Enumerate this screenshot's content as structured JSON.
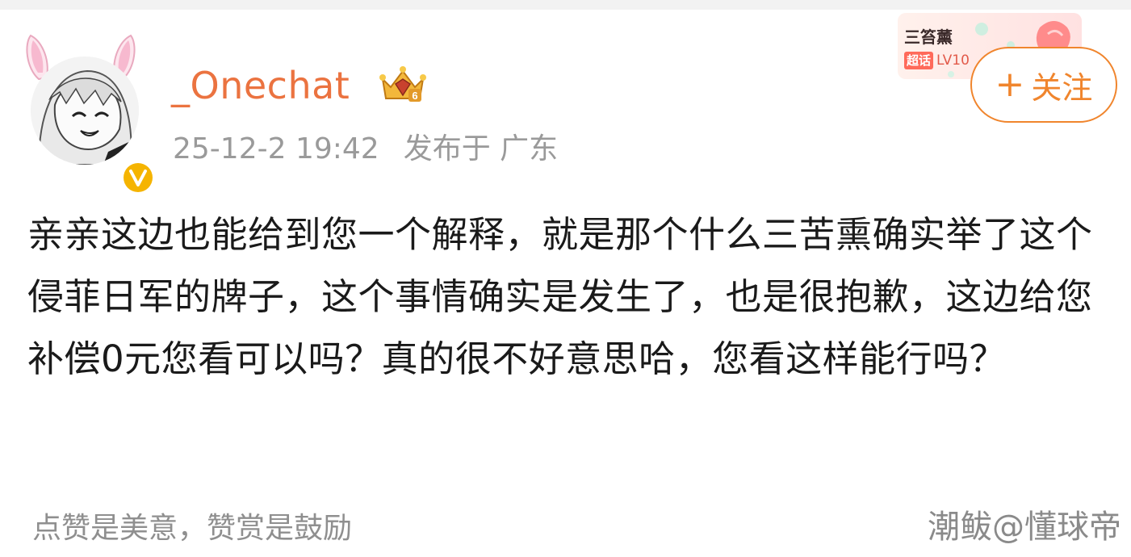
{
  "post": {
    "author": {
      "username": "_Onechat",
      "verified_mark": "V",
      "crown_level": "6"
    },
    "timestamp": "25-12-2 19:42",
    "location": "发布于 广东",
    "body": "亲亲这边也能给到您一个解释，就是那个什么三苦熏确实举了这个侵菲日军的牌子，这个事情确实是发生了，也是很抱歉，这边给您补偿0元您看可以吗？真的很不好意思哈，您看这样能行吗？"
  },
  "supertopic": {
    "name": "三笞薰",
    "chip": "超话",
    "level": "LV10"
  },
  "follow_button": {
    "plus": "+",
    "label": "关注"
  },
  "footer": {
    "left_text": "点赞是美意，赞赏是鼓励",
    "watermark": "潮鲅@懂球帝"
  },
  "colors": {
    "accent_orange": "#f0852d",
    "username_orange": "#eb7340",
    "meta_gray": "#9a9a9a",
    "verify_yellow": "#f5b400"
  },
  "icons": {
    "crown": "crown-badge-icon",
    "verify": "verified-v-icon",
    "ears": "bunny-ears-icon"
  }
}
